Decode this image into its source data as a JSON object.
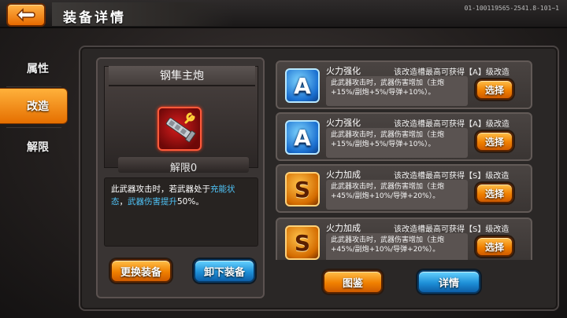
{
  "header": {
    "title": "装备详情",
    "code": "01-100119565-2541.8-101~1"
  },
  "sidebar": {
    "items": [
      {
        "label": "属性",
        "active": false
      },
      {
        "label": "改造",
        "active": true
      },
      {
        "label": "解限",
        "active": false
      }
    ]
  },
  "weapon": {
    "name": "钢隼主炮",
    "unlock": "解限0",
    "desc_part1": "此武器攻击时，若武器处于",
    "desc_hl1": "充能状态",
    "desc_part2": "，",
    "desc_hl2": "武器伤害提升",
    "desc_part3": "50%。"
  },
  "actions": {
    "replace": "更换装备",
    "unequip": "卸下装备",
    "codex": "图鉴",
    "detail": "详情"
  },
  "mods": [
    {
      "grade": "A",
      "name": "火力强化",
      "info": "该改造槽最高可获得【A】级改造",
      "desc": "此武器攻击时，武器伤害增加（主炮+15%/副炮+5%/导弹+10%）。",
      "button": "选择"
    },
    {
      "grade": "A",
      "name": "火力强化",
      "info": "该改造槽最高可获得【A】级改造",
      "desc": "此武器攻击时，武器伤害增加（主炮+15%/副炮+5%/导弹+10%）。",
      "button": "选择"
    },
    {
      "grade": "S",
      "name": "火力加成",
      "info": "该改造槽最高可获得【S】级改造",
      "desc": "此武器攻击时，武器伤害增加（主炮+45%/副炮+10%/导弹+20%）。",
      "button": "选择"
    },
    {
      "grade": "S",
      "name": "火力加成",
      "info": "该改造槽最高可获得【S】级改造",
      "desc": "此武器攻击时，武器伤害增加（主炮+45%/副炮+10%/导弹+20%）。",
      "button": "选择"
    }
  ],
  "colors": {
    "accent_orange": "#f08000",
    "accent_blue": "#1e90d8",
    "highlight_text": "#4fc3f7"
  }
}
